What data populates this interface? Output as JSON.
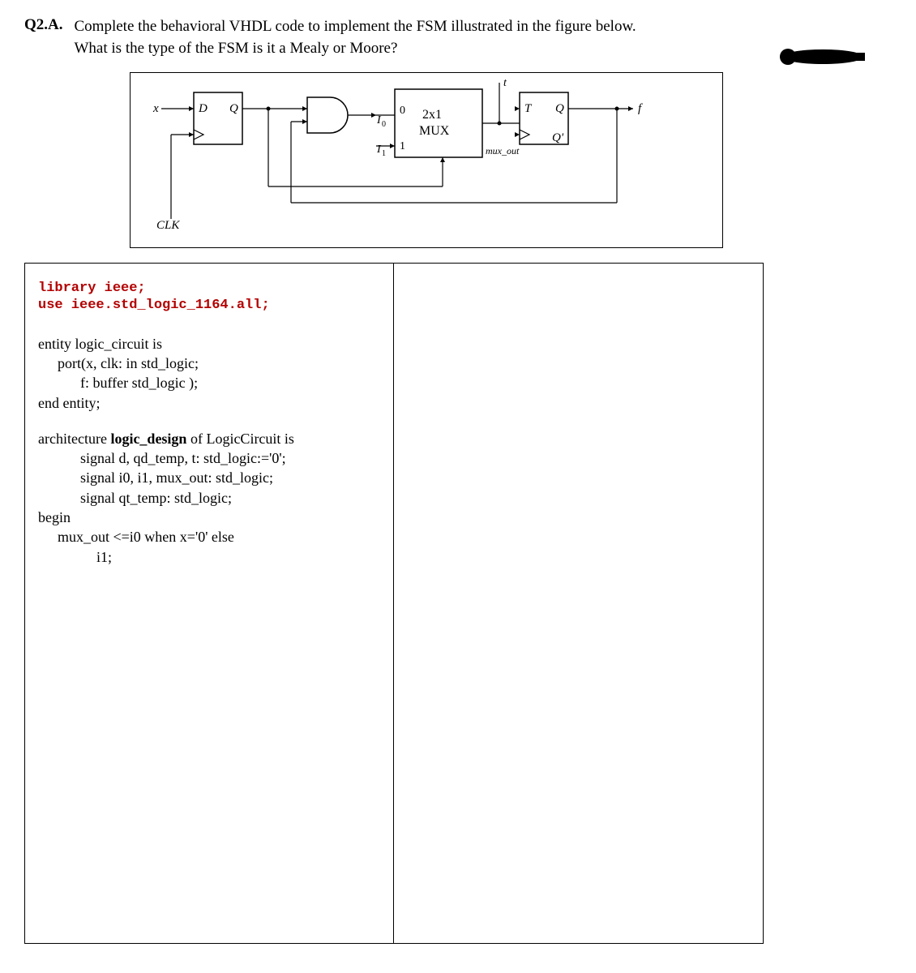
{
  "question": {
    "label": "Q2.A.",
    "text_line1": "Complete the behavioral VHDL code to implement the FSM illustrated in the figure below.",
    "text_line2": "What is the type of the FSM is it a Mealy or Moore?"
  },
  "figure": {
    "x_label": "x",
    "d_label": "D",
    "q1_label": "Q",
    "clk_label": "CLK",
    "i0_label": "I",
    "i0_sub": "0",
    "i1_label": "I",
    "i1_sub": "1",
    "zero": "0",
    "one": "1",
    "mux_l1": "2x1",
    "mux_l2": "MUX",
    "mux_out": "mux_out",
    "t_label": "t",
    "T_label": "T",
    "Qt_label": "Q",
    "Qtprime_label": "Q'",
    "f_label": "f"
  },
  "code": {
    "lib1": "library ieee;",
    "lib2": "use ieee.std_logic_1164.all;",
    "entity1": "entity logic_circuit is",
    "entity2": "port(x, clk: in std_logic;",
    "entity3": "f: buffer std_logic );",
    "entity4": "end entity;",
    "arch_pre": "architecture ",
    "arch_name": "logic_design",
    "arch_post": " of LogicCircuit is",
    "sig1": "signal d, qd_temp, t: std_logic:='0';",
    "sig2": "signal i0, i1, mux_out: std_logic;",
    "sig3": "signal qt_temp: std_logic;",
    "begin": "begin",
    "mux1": "mux_out <=i0 when x='0' else",
    "mux2": "i1;"
  }
}
